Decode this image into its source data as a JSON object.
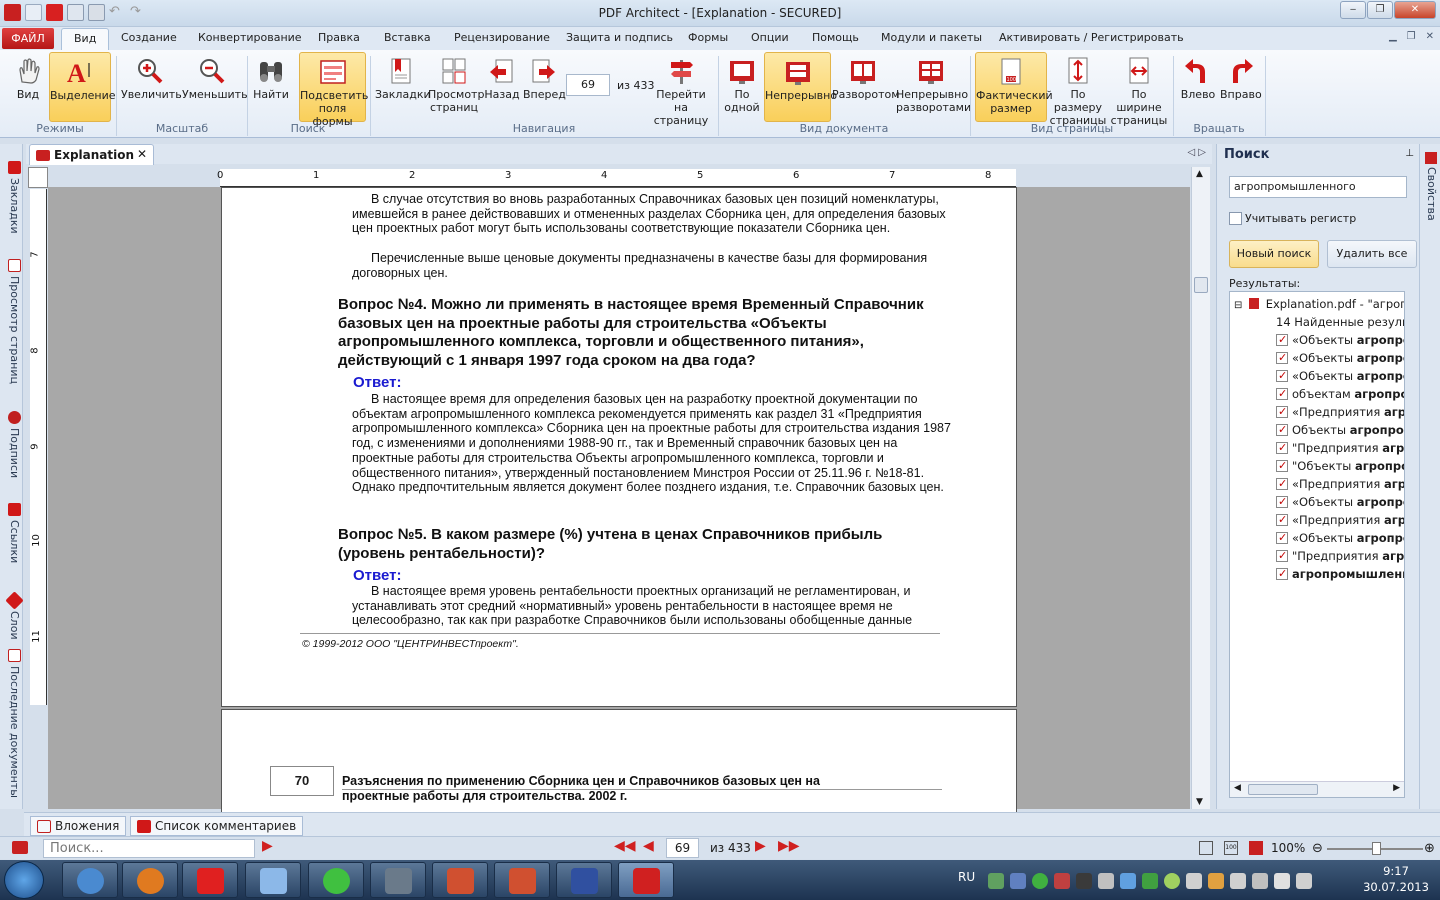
{
  "window": {
    "title": "PDF Architect - [Explanation - SECURED]"
  },
  "menu": {
    "file": "ФАЙЛ",
    "tabs": [
      "Вид",
      "Создание",
      "Конвертирование",
      "Правка",
      "Вставка",
      "Рецензирование",
      "Защита и подпись",
      "Формы",
      "Опции",
      "Помощь",
      "Модули и пакеты",
      "Активировать / Регистрировать"
    ]
  },
  "ribbon": {
    "buttons": [
      {
        "label": "Вид"
      },
      {
        "label": "Выделение"
      },
      {
        "label": "Увеличить"
      },
      {
        "label": "Уменьшить"
      },
      {
        "label": "Найти"
      },
      {
        "label": "Подсветить поля формы"
      },
      {
        "label": "Закладки"
      },
      {
        "label": "Просмотр страниц"
      },
      {
        "label": "Назад"
      },
      {
        "label": "Вперед"
      },
      {
        "label": "Перейти на страницу"
      },
      {
        "label": "По одной"
      },
      {
        "label": "Непрерывно"
      },
      {
        "label": "Разворотом"
      },
      {
        "label": "Непрерывно разворотами"
      },
      {
        "label": "Фактический размер"
      },
      {
        "label": "По размеру страницы"
      },
      {
        "label": "По ширине страницы"
      },
      {
        "label": "Влево"
      },
      {
        "label": "Вправо"
      }
    ],
    "groups": [
      "Режимы",
      "Масштаб",
      "Поиск",
      "Навигация",
      "Вид документа",
      "Вид страницы",
      "Вращать"
    ],
    "page_current": "69",
    "page_total_label": "из 433"
  },
  "left_sidebar": [
    "Закладки",
    "Просмотр страниц",
    "Подписи",
    "Ссылки",
    "Слои",
    "Последние документы"
  ],
  "document_tab": {
    "label": "Explanation",
    "close": "✕"
  },
  "ruler": {
    "h": [
      "0",
      "1",
      "2",
      "3",
      "4",
      "5",
      "6",
      "7",
      "8"
    ],
    "v": [
      "7",
      "8",
      "9",
      "10",
      "11"
    ]
  },
  "page69": {
    "para1": "В случае отсутствия во вновь разработанных Справочниках базовых цен позиций номенклатуры, имевшейся в ранее действовавших и отмененных разделах Сборника цен, для определения базовых цен проектных работ могут быть использованы соответствующие показатели Сборника цен.",
    "para2": "Перечисленные выше ценовые документы предназначены в качестве базы для формирования договорных цен.",
    "q4": "Вопрос №4. Можно ли применять в настоящее время Временный Справочник базовых цен на проектные работы для строительства «Объекты агропромышленного комплекса, торговли и общественного питания», действующий с 1 января 1997 года сроком на два года?",
    "answer_label": "Ответ:",
    "a4": "В настоящее время для определения базовых цен на разработку проектной документации по объектам агропромышленного комплекса рекомендуется применять как раздел 31 «Предприятия агропромышленного комплекса» Сборника цен на проектные работы для строительства издания 1987 год, с изменениями и дополнениями 1988-90 гг., так и Временный справочник базовых цен на проектные работы для строительства Объекты агропромышленного комплекса, торговли и общественного питания», утвержденный постановлением Минстроя России от 25.11.96 г. №18-81. Однако предпочтительным является документ более позднего издания, т.е. Справочник базовых цен.",
    "q5": "Вопрос №5. В каком размере (%) учтена в ценах Справочников прибыль (уровень рентабельности)?",
    "a5": "В настоящее время уровень рентабельности проектных организаций не регламентирован, и устанавливать этот средний «нормативный» уровень рентабельности в настоящее время не целесообразно, так как при разработке Справочников были использованы обобщенные данные",
    "copyright": "© 1999-2012 ООО \"ЦЕНТРИНВЕСТпроект\"."
  },
  "page70": {
    "number": "70",
    "header": "Разъяснения по применению Сборника цен и Справочников базовых цен на проектные работы для строительства. 2002 г."
  },
  "search_panel": {
    "title": "Поиск",
    "query": "агропромышленного",
    "case_label": "Учитывать регистр",
    "new_search": "Новый поиск",
    "delete_all": "Удалить все",
    "results_label": "Результаты:",
    "root": "Explanation.pdf - \"агроп",
    "count": "14 Найденные результ",
    "results": [
      {
        "pre": "«Объекты ",
        "hit": "агропро"
      },
      {
        "pre": "«Объекты ",
        "hit": "агропро"
      },
      {
        "pre": "«Объекты ",
        "hit": "агропро"
      },
      {
        "pre": "объектам ",
        "hit": "агропром"
      },
      {
        "pre": "«Предприятия ",
        "hit": "агро"
      },
      {
        "pre": "Объекты ",
        "hit": "агропром"
      },
      {
        "pre": "\"Предприятия ",
        "hit": "агро"
      },
      {
        "pre": "\"Объекты ",
        "hit": "агропрог"
      },
      {
        "pre": "«Предприятия ",
        "hit": "агро"
      },
      {
        "pre": "«Объекты ",
        "hit": "агропро"
      },
      {
        "pre": "«Предприятия ",
        "hit": "агро"
      },
      {
        "pre": "«Объекты ",
        "hit": "агропро"
      },
      {
        "pre": "\"Предприятия ",
        "hit": "агро"
      },
      {
        "pre": "",
        "hit": "агропромышлени"
      }
    ]
  },
  "right_sidebar": {
    "label": "Свойства"
  },
  "bottom_tabs": [
    "Вложения",
    "Список комментариев"
  ],
  "statusbar": {
    "search_placeholder": "Поиск...",
    "page": "69",
    "of": "из 433",
    "zoom": "100%"
  },
  "taskbar": {
    "lang": "RU",
    "time": "9:17",
    "date": "30.07.2013"
  },
  "colors": {
    "accent": "#c81e1e",
    "highlight": "#f9cf5a",
    "answer": "#1a1ad0"
  }
}
